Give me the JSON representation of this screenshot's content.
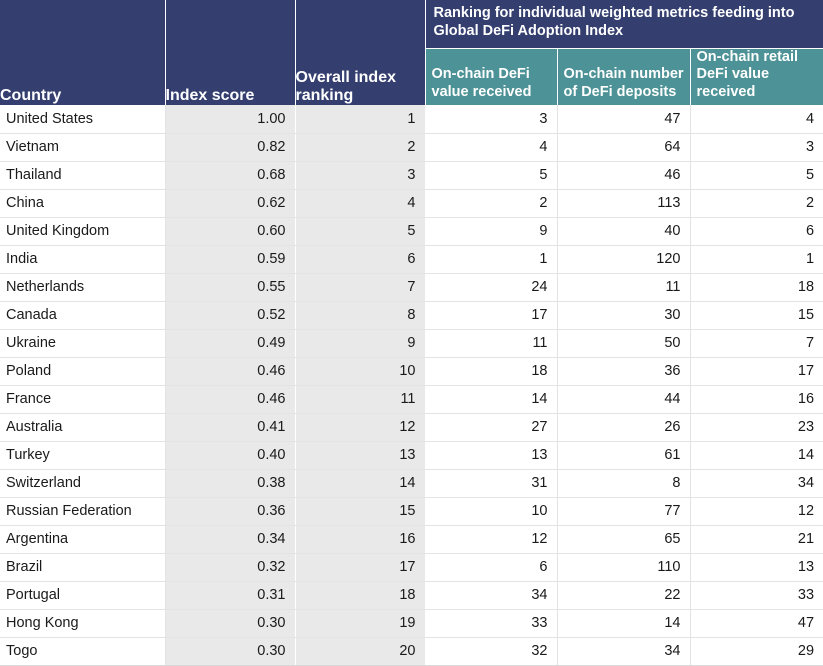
{
  "table": {
    "group_header": "Ranking for individual weighted metrics feeding into Global DeFi Adoption Index",
    "columns": {
      "country": "Country",
      "index_score": "Index score",
      "overall_rank": "Overall index ranking",
      "metric1": "On-chain DeFi value received",
      "metric2": "On-chain number of DeFi deposits",
      "metric3": "On-chain retail DeFi value received"
    },
    "colors": {
      "header_navy": "#343f70",
      "subheader_teal": "#4d9296",
      "shaded_cell": "#e9e9e9",
      "grid_line": "#e3e3e3",
      "text_dark": "#1a1a1a",
      "header_text": "#ffffff"
    },
    "rows": [
      {
        "country": "United States",
        "index_score": "1.00",
        "overall_rank": "1",
        "metric1": "3",
        "metric2": "47",
        "metric3": "4"
      },
      {
        "country": "Vietnam",
        "index_score": "0.82",
        "overall_rank": "2",
        "metric1": "4",
        "metric2": "64",
        "metric3": "3"
      },
      {
        "country": "Thailand",
        "index_score": "0.68",
        "overall_rank": "3",
        "metric1": "5",
        "metric2": "46",
        "metric3": "5"
      },
      {
        "country": "China",
        "index_score": "0.62",
        "overall_rank": "4",
        "metric1": "2",
        "metric2": "113",
        "metric3": "2"
      },
      {
        "country": "United Kingdom",
        "index_score": "0.60",
        "overall_rank": "5",
        "metric1": "9",
        "metric2": "40",
        "metric3": "6"
      },
      {
        "country": "India",
        "index_score": "0.59",
        "overall_rank": "6",
        "metric1": "1",
        "metric2": "120",
        "metric3": "1"
      },
      {
        "country": "Netherlands",
        "index_score": "0.55",
        "overall_rank": "7",
        "metric1": "24",
        "metric2": "11",
        "metric3": "18"
      },
      {
        "country": "Canada",
        "index_score": "0.52",
        "overall_rank": "8",
        "metric1": "17",
        "metric2": "30",
        "metric3": "15"
      },
      {
        "country": "Ukraine",
        "index_score": "0.49",
        "overall_rank": "9",
        "metric1": "11",
        "metric2": "50",
        "metric3": "7"
      },
      {
        "country": "Poland",
        "index_score": "0.46",
        "overall_rank": "10",
        "metric1": "18",
        "metric2": "36",
        "metric3": "17"
      },
      {
        "country": "France",
        "index_score": "0.46",
        "overall_rank": "11",
        "metric1": "14",
        "metric2": "44",
        "metric3": "16"
      },
      {
        "country": "Australia",
        "index_score": "0.41",
        "overall_rank": "12",
        "metric1": "27",
        "metric2": "26",
        "metric3": "23"
      },
      {
        "country": "Turkey",
        "index_score": "0.40",
        "overall_rank": "13",
        "metric1": "13",
        "metric2": "61",
        "metric3": "14"
      },
      {
        "country": "Switzerland",
        "index_score": "0.38",
        "overall_rank": "14",
        "metric1": "31",
        "metric2": "8",
        "metric3": "34"
      },
      {
        "country": "Russian Federation",
        "index_score": "0.36",
        "overall_rank": "15",
        "metric1": "10",
        "metric2": "77",
        "metric3": "12"
      },
      {
        "country": "Argentina",
        "index_score": "0.34",
        "overall_rank": "16",
        "metric1": "12",
        "metric2": "65",
        "metric3": "21"
      },
      {
        "country": "Brazil",
        "index_score": "0.32",
        "overall_rank": "17",
        "metric1": "6",
        "metric2": "110",
        "metric3": "13"
      },
      {
        "country": "Portugal",
        "index_score": "0.31",
        "overall_rank": "18",
        "metric1": "34",
        "metric2": "22",
        "metric3": "33"
      },
      {
        "country": "Hong Kong",
        "index_score": "0.30",
        "overall_rank": "19",
        "metric1": "33",
        "metric2": "14",
        "metric3": "47"
      },
      {
        "country": "Togo",
        "index_score": "0.30",
        "overall_rank": "20",
        "metric1": "32",
        "metric2": "34",
        "metric3": "29"
      }
    ]
  }
}
